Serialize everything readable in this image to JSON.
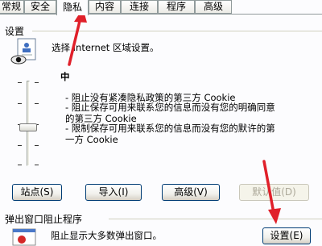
{
  "tabs": [
    {
      "label": "常规",
      "active": false
    },
    {
      "label": "安全",
      "active": false
    },
    {
      "label": "隐私",
      "active": true
    },
    {
      "label": "内容",
      "active": false
    },
    {
      "label": "连接",
      "active": false
    },
    {
      "label": "程序",
      "active": false
    },
    {
      "label": "高级",
      "active": false
    }
  ],
  "settings_section": {
    "label": "设置",
    "description": "选择 Internet 区域设置。",
    "level": "中",
    "level_position_fraction": 0.5,
    "bullets": [
      "- 阻止没有紧凑隐私政策的第三方 Cookie",
      "- 阻止保存可用来联系您的信息而没有您的明确同意\n的第三方 Cookie",
      "- 限制保存可用来联系您的信息而没有您的默许的第\n一方 Cookie"
    ]
  },
  "buttons": {
    "sites": "站点(S)",
    "import": "导入(I)",
    "advanced": "高级(V)",
    "default": "默认值(D)"
  },
  "popup_section": {
    "label": "弹出窗口阻止程序",
    "description": "阻止显示大多数弹出窗口。",
    "settings_button": "设置(E)"
  },
  "colors": {
    "annotation_arrow": "#e0202a",
    "active_tab_accent": "#ffc83c",
    "button_border": "#003c74"
  }
}
